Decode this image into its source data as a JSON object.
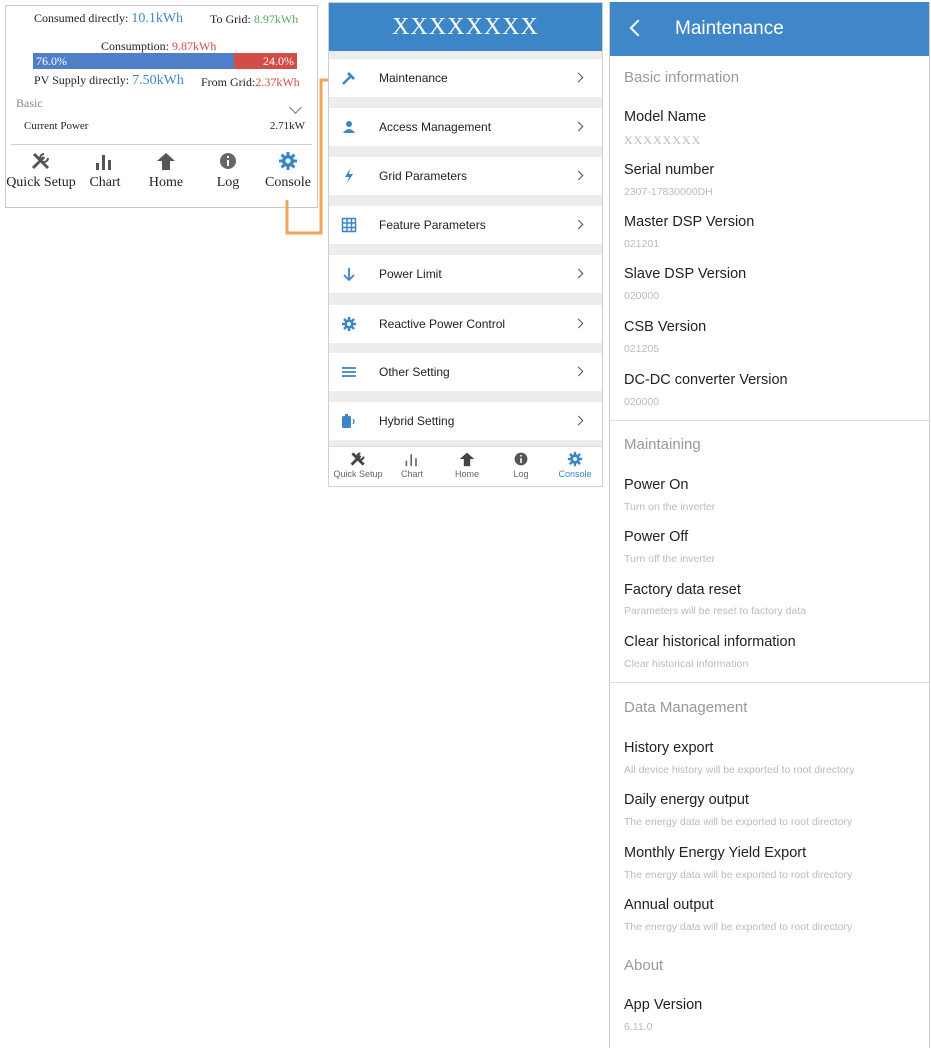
{
  "home": {
    "consumed_directly_label": "Consumed directly:",
    "consumed_directly_value": "10.1kWh",
    "to_grid_label": "To Grid:",
    "to_grid_value": "8.97kWh",
    "consumption_label": "Consumption:",
    "consumption_value": "9.87kWh",
    "bar_left_pct": "76.0%",
    "bar_right_pct": "24.0%",
    "bar_left_fraction": 0.76,
    "pv_supply_label": "PV Supply directly:",
    "pv_supply_value": "7.50kWh",
    "from_grid_label": "From Grid:",
    "from_grid_value": "2.37kWh",
    "basic_label": "Basic",
    "current_power_label": "Current Power",
    "current_power_value": "2.71kW",
    "nav": [
      "Quick Setup",
      "Chart",
      "Home",
      "Log",
      "Console"
    ]
  },
  "console": {
    "title": "XXXXXXXX",
    "items": [
      {
        "label": "Maintenance",
        "icon": "hammer-icon"
      },
      {
        "label": "Access Management",
        "icon": "person-icon"
      },
      {
        "label": "Grid Parameters",
        "icon": "lightning-icon"
      },
      {
        "label": "Feature Parameters",
        "icon": "grid-table-icon"
      },
      {
        "label": "Power Limit",
        "icon": "arrow-down-icon"
      },
      {
        "label": "Reactive Power Control",
        "icon": "gear-icon"
      },
      {
        "label": "Other Setting",
        "icon": "menu-lines-icon"
      },
      {
        "label": "Hybrid Setting",
        "icon": "battery-icon"
      }
    ],
    "nav": [
      "Quick Setup",
      "Chart",
      "Home",
      "Log",
      "Console"
    ],
    "active_nav": "Console"
  },
  "maintenance": {
    "title": "Maintenance",
    "basic_info_header": "Basic information",
    "model_name_label": "Model Name",
    "model_name_value": "XXXXXXXX",
    "serial_label": "Serial number",
    "serial_value": "2307-17830000DH",
    "master_dsp_label": "Master DSP Version",
    "master_dsp_value": "021201",
    "slave_dsp_label": "Slave DSP Version",
    "slave_dsp_value": "020000",
    "csb_label": "CSB Version",
    "csb_value": "021205",
    "dcdc_label": "DC-DC converter Version",
    "dcdc_value": "020000",
    "maintaining_header": "Maintaining",
    "power_on_label": "Power On",
    "power_on_desc": "Turn on the inverter",
    "power_off_label": "Power Off",
    "power_off_desc": "Turn off the inverter",
    "factory_reset_label": "Factory data reset",
    "factory_reset_desc": "Parameters will be reset to factory data",
    "clear_hist_label": "Clear historical information",
    "clear_hist_desc": "Clear historical information",
    "data_mgmt_header": "Data Management",
    "history_export_label": "History export",
    "history_export_desc": "All device history will be exported to root directory",
    "daily_label": "Daily energy output",
    "daily_desc": "The energy data will be exported to root directory",
    "monthly_label": "Monthly Energy Yield Export",
    "monthly_desc": "The energy data will be exported to root directory",
    "annual_label": "Annual output",
    "annual_desc": "The energy data will be exported to root directory",
    "about_header": "About",
    "app_version_label": "App Version",
    "app_version_value": "6.11.0"
  },
  "colors": {
    "header_blue": "#3c86c8",
    "connector_orange": "#f0a35a",
    "bar_blue": "#4f7fc8",
    "bar_red": "#d34d48"
  }
}
